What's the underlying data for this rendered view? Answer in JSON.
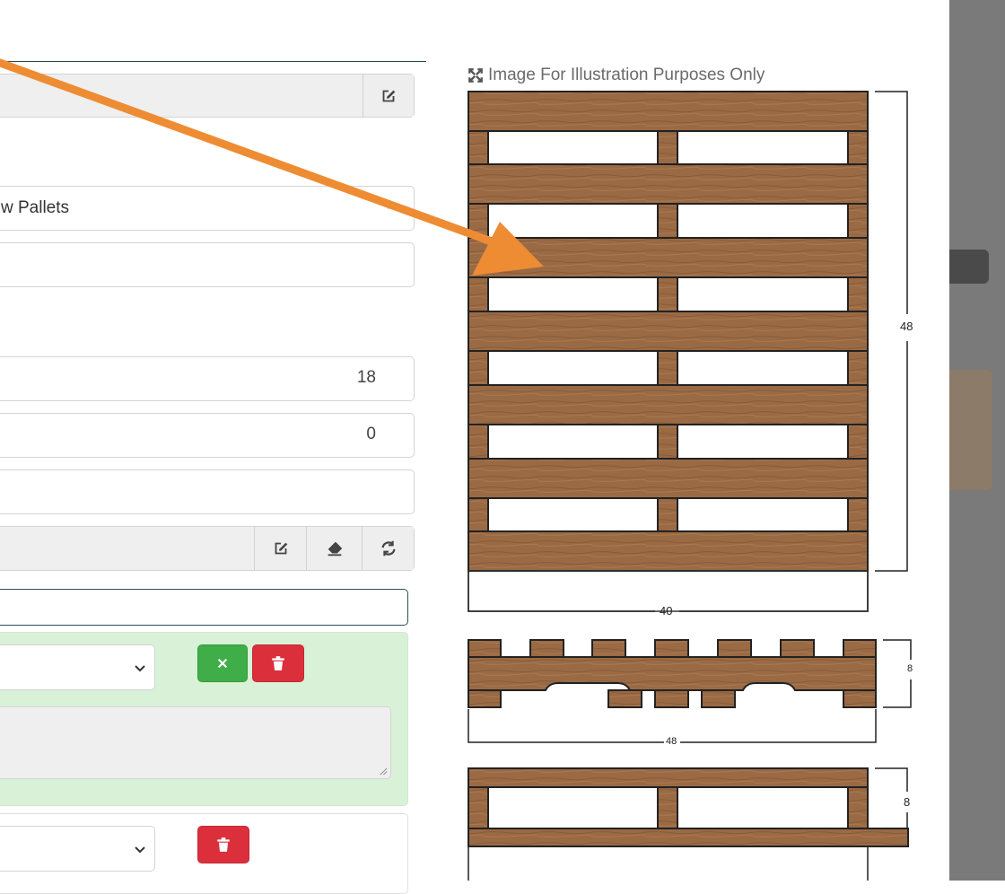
{
  "form": {
    "pallet_type_value": "w Pallets",
    "length_value": "18",
    "qty_value": "0"
  },
  "illustration": {
    "caption": "Image For Illustration Purposes Only",
    "top_view_height": "48",
    "top_view_width": "40",
    "side_view_height": "8",
    "side_view_length": "48",
    "end_view_height": "8"
  },
  "icons": {
    "edit": "edit-icon",
    "eraser": "eraser-icon",
    "refresh": "refresh-icon",
    "close": "close-icon",
    "trash": "trash-icon",
    "chevron": "chevron-down-icon",
    "expand": "expand-icon"
  },
  "colors": {
    "wood": "#9a6a45",
    "annotation_arrow": "#ee8c34",
    "success": "#3fae49",
    "danger": "#dc2f3c",
    "highlight_panel": "#d9f1d6"
  }
}
